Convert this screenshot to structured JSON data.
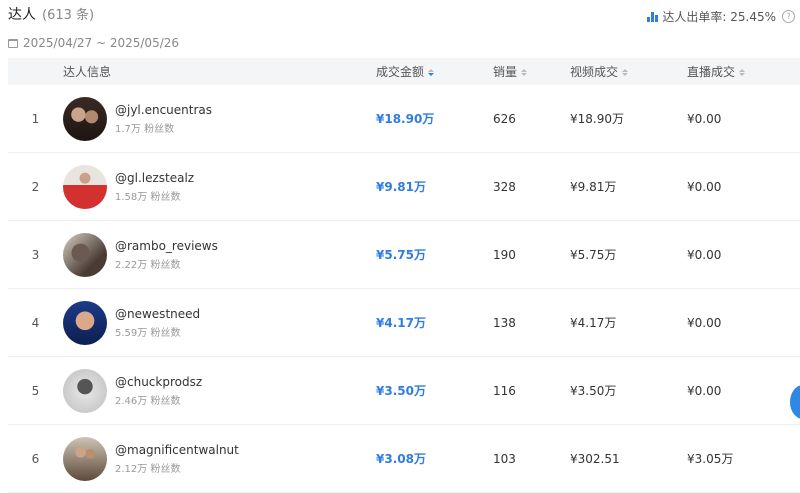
{
  "header": {
    "title": "达人",
    "count": "(613 条)",
    "rate_label": "达人出单率: 25.45%",
    "help": "?"
  },
  "date_range": "2025/04/27 ~ 2025/05/26",
  "columns": {
    "info": "达人信息",
    "gmv": "成交金额",
    "sales": "销量",
    "video": "视频成交",
    "live": "直播成交"
  },
  "rows": [
    {
      "idx": "1",
      "name": "@jyl.encuentras",
      "fans": "1.7万 粉丝数",
      "gmv": "¥18.90万",
      "sales": "626",
      "video": "¥18.90万",
      "live": "¥0.00"
    },
    {
      "idx": "2",
      "name": "@gl.lezstealz",
      "fans": "1.58万 粉丝数",
      "gmv": "¥9.81万",
      "sales": "328",
      "video": "¥9.81万",
      "live": "¥0.00"
    },
    {
      "idx": "3",
      "name": "@rambo_reviews",
      "fans": "2.22万 粉丝数",
      "gmv": "¥5.75万",
      "sales": "190",
      "video": "¥5.75万",
      "live": "¥0.00"
    },
    {
      "idx": "4",
      "name": "@newestneed",
      "fans": "5.59万 粉丝数",
      "gmv": "¥4.17万",
      "sales": "138",
      "video": "¥4.17万",
      "live": "¥0.00"
    },
    {
      "idx": "5",
      "name": "@chuckprodsz",
      "fans": "2.46万 粉丝数",
      "gmv": "¥3.50万",
      "sales": "116",
      "video": "¥3.50万",
      "live": "¥0.00"
    },
    {
      "idx": "6",
      "name": "@magnificentwalnut",
      "fans": "2.12万 粉丝数",
      "gmv": "¥3.08万",
      "sales": "103",
      "video": "¥302.51",
      "live": "¥3.05万"
    }
  ],
  "colors": {
    "accent": "#2f7de1",
    "header_bg": "#f4f5f7"
  }
}
